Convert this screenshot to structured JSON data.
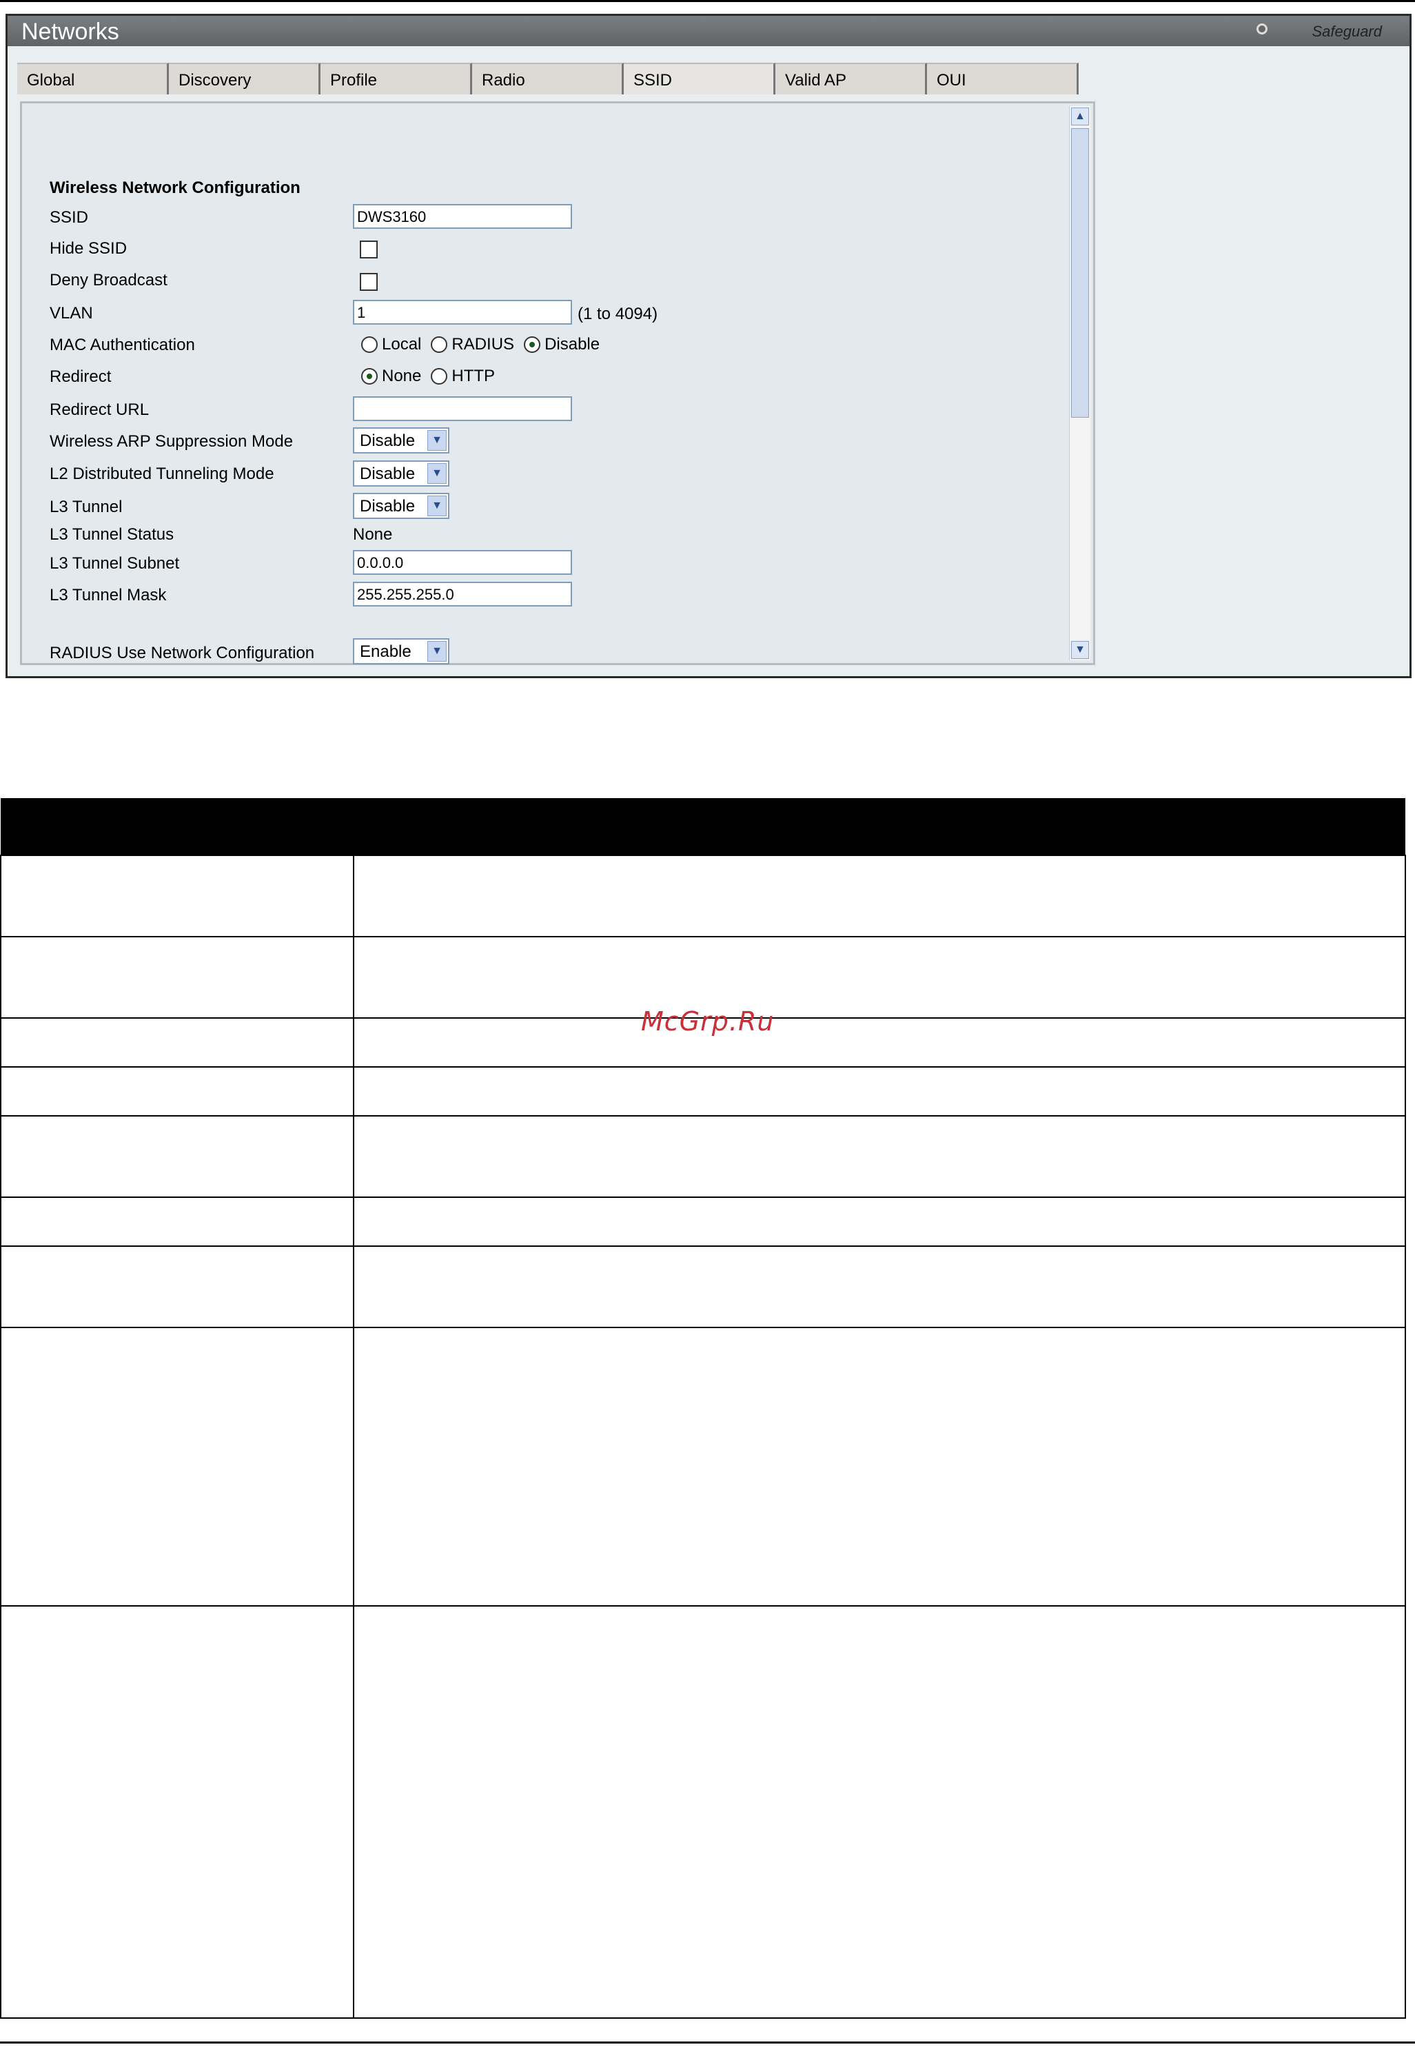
{
  "window": {
    "title": "Networks",
    "brand": "Safeguard"
  },
  "tabs": [
    {
      "label": "Global"
    },
    {
      "label": "Discovery"
    },
    {
      "label": "Profile"
    },
    {
      "label": "Radio"
    },
    {
      "label": "SSID",
      "active": true
    },
    {
      "label": "Valid AP"
    },
    {
      "label": "OUI"
    }
  ],
  "form": {
    "section_title": "Wireless Network Configuration",
    "ssid": {
      "label": "SSID",
      "value": "DWS3160"
    },
    "hide_ssid": {
      "label": "Hide SSID",
      "checked": false
    },
    "deny_broadcast": {
      "label": "Deny Broadcast",
      "checked": false
    },
    "vlan": {
      "label": "VLAN",
      "value": "1",
      "hint": "(1 to 4094)"
    },
    "mac_auth": {
      "label": "MAC Authentication",
      "options": [
        "Local",
        "RADIUS",
        "Disable"
      ],
      "selected": "Disable"
    },
    "redirect": {
      "label": "Redirect",
      "options": [
        "None",
        "HTTP"
      ],
      "selected": "None"
    },
    "redirect_url": {
      "label": "Redirect URL",
      "value": ""
    },
    "arp_suppression": {
      "label": "Wireless ARP Suppression Mode",
      "value": "Disable"
    },
    "l2_tunneling": {
      "label": "L2 Distributed Tunneling Mode",
      "value": "Disable"
    },
    "l3_tunnel": {
      "label": "L3 Tunnel",
      "value": "Disable"
    },
    "l3_tunnel_status": {
      "label": "L3 Tunnel Status",
      "value": "None"
    },
    "l3_tunnel_subnet": {
      "label": "L3 Tunnel Subnet",
      "value": "0.0.0.0"
    },
    "l3_tunnel_mask": {
      "label": "L3 Tunnel Mask",
      "value": "255.255.255.0"
    },
    "radius_use_network": {
      "label": "RADIUS Use Network Configuration",
      "value": "Enable"
    }
  },
  "watermark": "McGrp.Ru",
  "colors": {
    "title_bar": "#6a6e71",
    "tab_bg": "#ddd9d4",
    "panel_bg": "#e3e9ec",
    "watermark": "#c8303a"
  }
}
